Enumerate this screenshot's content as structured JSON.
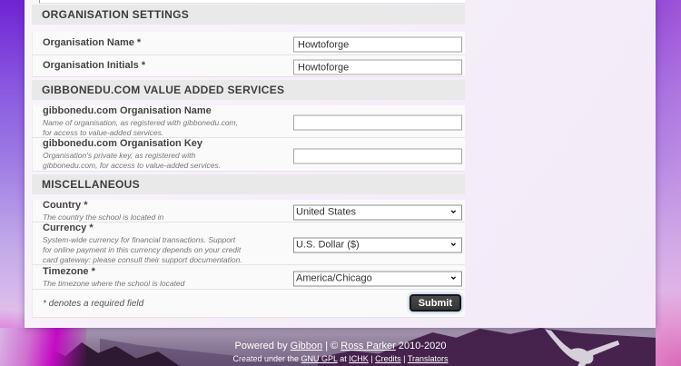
{
  "sections": {
    "organisation": {
      "title": "ORGANISATION SETTINGS"
    },
    "gibbonedu": {
      "title": "GIBBONEDU.COM VALUE ADDED SERVICES"
    },
    "misc": {
      "title": "MISCELLANEOUS"
    }
  },
  "fields": {
    "org_name": {
      "label": "Organisation Name *",
      "value": "Howtoforge"
    },
    "org_initials": {
      "label": "Organisation Initials *",
      "value": "Howtoforge"
    },
    "gibbonedu_name": {
      "label": "gibbonedu.com Organisation Name",
      "description": "Name of organisation, as registered with gibbonedu.com, for access to value-added services.",
      "value": ""
    },
    "gibbonedu_key": {
      "label": "gibbonedu.com Organisation Key",
      "description": "Organisation's private key, as registered with gibbonedu.com, for access to value-added services.",
      "value": ""
    },
    "country": {
      "label": "Country *",
      "description": "The country the school is located in",
      "selected": "United States"
    },
    "currency": {
      "label": "Currency *",
      "description": "System-wide currency for financial transactions. Support for online payment in this currency depends on your credit card gateway: please consult their support documentation.",
      "selected": "U.S. Dollar ($)"
    },
    "timezone": {
      "label": "Timezone *",
      "description": "The timezone where the school is located",
      "selected": "America/Chicago"
    }
  },
  "form_footer": {
    "required_note": "* denotes a required field",
    "submit_label": "Submit"
  },
  "footer": {
    "line1": {
      "prefix": "Powered by ",
      "gibbon_link": "Gibbon",
      "middle": " | © ",
      "ross_link": "Ross Parker",
      "years": " 2010-2020"
    },
    "line2": {
      "prefix": "Created under the ",
      "gpl_link": "GNU GPL",
      "at": " at ",
      "ichk_link": "ICHK",
      "sep1": " | ",
      "credits_link": "Credits",
      "sep2": " | ",
      "translators_link": "Translators"
    }
  },
  "icons": {
    "chevron_down": "⌄"
  },
  "colors": {
    "purple_top": "#6f24d3",
    "magenta_glow": "#c40ac4",
    "section_bar": "#e9e9e9",
    "submit_bg": "#3a3a3a",
    "footer_text": "#ffffff"
  }
}
